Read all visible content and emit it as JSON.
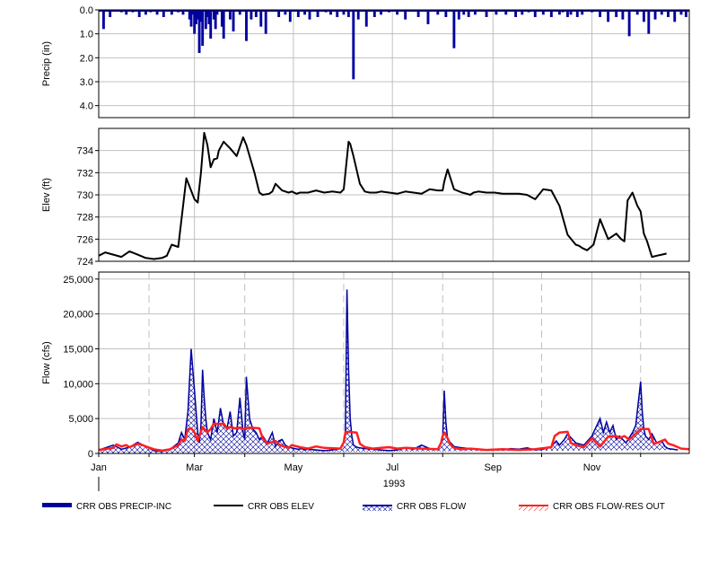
{
  "colors": {
    "precip": "#0000a0",
    "elev": "#000000",
    "flow": "#0000a0",
    "res_out": "#ff2020",
    "grid": "#c0c0c0",
    "dashed": "#c0c0c0"
  },
  "chart_data": [
    {
      "type": "bar",
      "ylabel": "Precip (in)",
      "ylim": [
        4.5,
        0.0
      ],
      "yticks": [
        "0.0",
        "1.0",
        "2.0",
        "3.0",
        "4.0"
      ],
      "ytick_values": [
        0,
        1,
        2,
        3,
        4
      ],
      "inverted": true,
      "grid": true,
      "x_days": [
        4,
        8,
        15,
        18,
        22,
        26,
        30,
        33,
        37,
        41,
        46,
        50,
        53,
        57,
        58,
        59,
        60,
        61,
        62,
        63,
        64,
        65,
        67,
        68,
        69,
        70,
        72,
        73,
        74,
        77,
        78,
        82,
        84,
        88,
        92,
        95,
        98,
        101,
        104,
        112,
        116,
        119,
        124,
        128,
        131,
        136,
        141,
        144,
        148,
        152,
        155,
        158,
        161,
        166,
        171,
        175,
        180,
        185,
        190,
        198,
        204,
        210,
        215,
        220,
        223,
        226,
        229,
        233,
        240,
        246,
        252,
        258,
        262,
        266,
        270,
        275,
        280,
        285,
        287,
        290,
        292,
        296,
        299,
        305,
        310,
        315,
        320,
        324,
        328,
        333,
        337,
        340,
        344,
        348,
        352,
        356,
        360,
        363
      ],
      "values": [
        0.8,
        0.3,
        0.1,
        0.2,
        0.1,
        0.3,
        0.2,
        0.1,
        0.2,
        0.3,
        0.2,
        0.1,
        0.2,
        0.4,
        0.7,
        0.2,
        1.0,
        0.6,
        0.4,
        1.8,
        0.5,
        1.5,
        0.8,
        0.3,
        0.6,
        1.2,
        0.4,
        0.8,
        0.2,
        0.7,
        1.2,
        0.4,
        0.9,
        0.2,
        1.3,
        0.4,
        0.3,
        0.7,
        1.0,
        0.3,
        0.2,
        0.5,
        0.3,
        0.2,
        0.4,
        0.3,
        0.1,
        0.2,
        0.3,
        0.2,
        0.3,
        2.9,
        0.4,
        0.7,
        0.3,
        0.2,
        0.1,
        0.2,
        0.4,
        0.3,
        0.6,
        0.2,
        0.3,
        1.6,
        0.4,
        0.2,
        0.3,
        0.2,
        0.3,
        0.2,
        0.2,
        0.3,
        0.2,
        0.1,
        0.3,
        0.2,
        0.3,
        0.2,
        0.1,
        0.3,
        0.2,
        0.3,
        0.2,
        0.1,
        0.3,
        0.5,
        0.3,
        0.4,
        1.1,
        0.2,
        0.5,
        1.0,
        0.4,
        0.2,
        0.3,
        0.5,
        0.2,
        0.3
      ]
    },
    {
      "type": "line",
      "ylabel": "Elev (ft)",
      "ylim": [
        724,
        736
      ],
      "yticks": [
        "724",
        "726",
        "728",
        "730",
        "732",
        "734"
      ],
      "ytick_values": [
        724,
        726,
        728,
        730,
        732,
        734
      ],
      "grid": true,
      "x_days": [
        1,
        5,
        10,
        15,
        20,
        25,
        30,
        35,
        40,
        43,
        46,
        50,
        55,
        60,
        62,
        64,
        66,
        68,
        70,
        72,
        74,
        75,
        78,
        82,
        86,
        90,
        92,
        95,
        97,
        100,
        102,
        106,
        108,
        110,
        114,
        118,
        120,
        123,
        125,
        130,
        135,
        140,
        145,
        150,
        152,
        155,
        156,
        158,
        162,
        165,
        168,
        172,
        175,
        180,
        185,
        190,
        195,
        200,
        205,
        210,
        213,
        214,
        216,
        220,
        225,
        228,
        230,
        232,
        235,
        240,
        245,
        250,
        255,
        260,
        265,
        270,
        275,
        280,
        285,
        290,
        295,
        297,
        299,
        302,
        306,
        310,
        315,
        320,
        323,
        325,
        327,
        330,
        333,
        335,
        337,
        339,
        342,
        345,
        348,
        351,
        354,
        357,
        360,
        365
      ],
      "values": [
        724.5,
        724.8,
        724.6,
        724.4,
        724.9,
        724.6,
        724.3,
        724.2,
        724.3,
        724.5,
        725.5,
        725.3,
        731.5,
        729.6,
        729.3,
        732.0,
        735.6,
        734.5,
        732.5,
        733.2,
        733.3,
        734.0,
        734.8,
        734.2,
        733.5,
        735.2,
        734.5,
        733.0,
        732.0,
        730.2,
        730.0,
        730.1,
        730.3,
        731.0,
        730.4,
        730.2,
        730.3,
        730.1,
        730.2,
        730.2,
        730.4,
        730.2,
        730.3,
        730.2,
        730.5,
        734.8,
        734.6,
        733.5,
        731.0,
        730.3,
        730.2,
        730.2,
        730.3,
        730.2,
        730.1,
        730.3,
        730.2,
        730.1,
        730.5,
        730.4,
        730.4,
        731.2,
        732.3,
        730.5,
        730.2,
        730.1,
        730.0,
        730.2,
        730.3,
        730.2,
        730.2,
        730.1,
        730.1,
        730.1,
        730.0,
        729.6,
        730.5,
        730.4,
        729.0,
        726.4,
        725.5,
        725.4,
        725.2,
        725.0,
        725.5,
        727.8,
        726.0,
        726.5,
        726.0,
        725.8,
        729.5,
        730.2,
        729.0,
        728.5,
        726.5,
        725.8,
        724.4,
        724.5,
        724.6,
        724.7
      ]
    },
    {
      "type": "area",
      "ylabel": "Flow (cfs)",
      "ylim": [
        0,
        26000
      ],
      "yticks": [
        "0",
        "5,000",
        "10,000",
        "15,000",
        "20,000",
        "25,000"
      ],
      "ytick_values": [
        0,
        5000,
        10000,
        15000,
        20000,
        25000
      ],
      "xlabel": "1993",
      "xticks": [
        "Jan",
        "Mar",
        "May",
        "Jul",
        "Sep",
        "Nov"
      ],
      "xtick_days": [
        1,
        60,
        121,
        182,
        244,
        305
      ],
      "grid": true,
      "dashed_days": [
        32,
        91,
        152,
        213,
        274,
        335
      ],
      "series": [
        {
          "name": "CRR OBS FLOW",
          "x_days": [
            1,
            5,
            10,
            15,
            20,
            25,
            30,
            35,
            40,
            45,
            50,
            52,
            54,
            56,
            58,
            60,
            62,
            63,
            64,
            65,
            66,
            67,
            68,
            70,
            72,
            74,
            76,
            78,
            80,
            82,
            84,
            86,
            88,
            90,
            91,
            92,
            94,
            96,
            98,
            100,
            102,
            105,
            108,
            110,
            112,
            114,
            116,
            118,
            120,
            122,
            124,
            126,
            128,
            130,
            135,
            140,
            145,
            150,
            152,
            153,
            154,
            155,
            156,
            157,
            158,
            160,
            162,
            165,
            170,
            175,
            180,
            185,
            190,
            195,
            200,
            205,
            210,
            213,
            214,
            215,
            216,
            218,
            220,
            222,
            225,
            230,
            235,
            240,
            245,
            250,
            255,
            260,
            265,
            270,
            275,
            280,
            283,
            285,
            288,
            290,
            295,
            300,
            305,
            310,
            312,
            314,
            316,
            318,
            320,
            322,
            324,
            326,
            330,
            332,
            335,
            336,
            337,
            338,
            340,
            342,
            345,
            348,
            350,
            352,
            355,
            358,
            360,
            365
          ],
          "values": [
            500,
            800,
            1200,
            600,
            900,
            1600,
            1000,
            400,
            300,
            600,
            1500,
            3000,
            2000,
            6000,
            15000,
            9000,
            3000,
            1500,
            4000,
            12000,
            8000,
            5000,
            3000,
            2000,
            5000,
            3000,
            6500,
            4000,
            3500,
            6000,
            2500,
            3000,
            8000,
            3000,
            2000,
            11000,
            5000,
            3500,
            3000,
            2000,
            2500,
            1500,
            3000,
            1000,
            1800,
            2000,
            1200,
            900,
            800,
            700,
            600,
            700,
            500,
            600,
            500,
            400,
            500,
            700,
            1500,
            3000,
            23500,
            12000,
            5000,
            2500,
            1200,
            900,
            800,
            700,
            600,
            500,
            400,
            500,
            800,
            600,
            1200,
            700,
            600,
            2000,
            9000,
            4500,
            2000,
            1500,
            1000,
            900,
            800,
            700,
            600,
            500,
            600,
            500,
            700,
            600,
            800,
            500,
            600,
            1000,
            1800,
            1200,
            2000,
            2800,
            1500,
            1200,
            2500,
            5000,
            3000,
            4500,
            3000,
            4000,
            2000,
            2500,
            2000,
            1500,
            3000,
            4000,
            10300,
            6000,
            3500,
            2500,
            2000,
            2800,
            1500,
            1800,
            1000,
            700,
            600,
            500
          ],
          "style": "area-hatched"
        },
        {
          "name": "CRR OBS FLOW-RES OUT",
          "x_days": [
            1,
            10,
            12,
            15,
            18,
            20,
            25,
            28,
            30,
            35,
            40,
            45,
            50,
            52,
            54,
            56,
            58,
            60,
            62,
            65,
            68,
            70,
            72,
            75,
            78,
            80,
            82,
            85,
            88,
            90,
            92,
            95,
            100,
            102,
            105,
            110,
            112,
            115,
            118,
            120,
            125,
            130,
            135,
            140,
            150,
            152,
            153,
            154,
            160,
            162,
            165,
            170,
            175,
            180,
            185,
            190,
            200,
            210,
            212,
            213,
            214,
            216,
            218,
            220,
            222,
            225,
            230,
            240,
            250,
            260,
            270,
            280,
            282,
            285,
            290,
            292,
            295,
            300,
            305,
            310,
            315,
            320,
            322,
            325,
            328,
            330,
            335,
            340,
            343,
            345,
            350,
            352,
            355,
            358,
            360,
            365
          ],
          "values": [
            500,
            800,
            1300,
            1000,
            1200,
            900,
            1400,
            1200,
            1000,
            600,
            400,
            600,
            1200,
            2000,
            1800,
            3500,
            3600,
            3000,
            1800,
            3800,
            3000,
            3500,
            4300,
            4200,
            4300,
            3600,
            3800,
            3600,
            3700,
            3500,
            3600,
            3700,
            3600,
            2200,
            1400,
            1800,
            1300,
            1000,
            800,
            1200,
            900,
            700,
            1000,
            800,
            700,
            1600,
            3000,
            3100,
            3000,
            1400,
            900,
            700,
            800,
            900,
            700,
            800,
            700,
            600,
            1500,
            2500,
            3000,
            2200,
            1200,
            800,
            700,
            600,
            700,
            500,
            600,
            500,
            600,
            900,
            2500,
            3000,
            3100,
            1500,
            1200,
            900,
            2200,
            1000,
            2400,
            2500,
            2200,
            2500,
            2000,
            2400,
            3500,
            3500,
            1400,
            1500,
            2000,
            1400,
            1200,
            900,
            700,
            600
          ],
          "style": "line"
        }
      ]
    }
  ],
  "legend": [
    {
      "label": "CRR OBS PRECIP-INC",
      "kind": "thick-bar"
    },
    {
      "label": "CRR OBS ELEV",
      "kind": "line"
    },
    {
      "label": "CRR OBS FLOW",
      "kind": "hatch-blue"
    },
    {
      "label": "CRR OBS FLOW-RES OUT",
      "kind": "hatch-red"
    }
  ]
}
